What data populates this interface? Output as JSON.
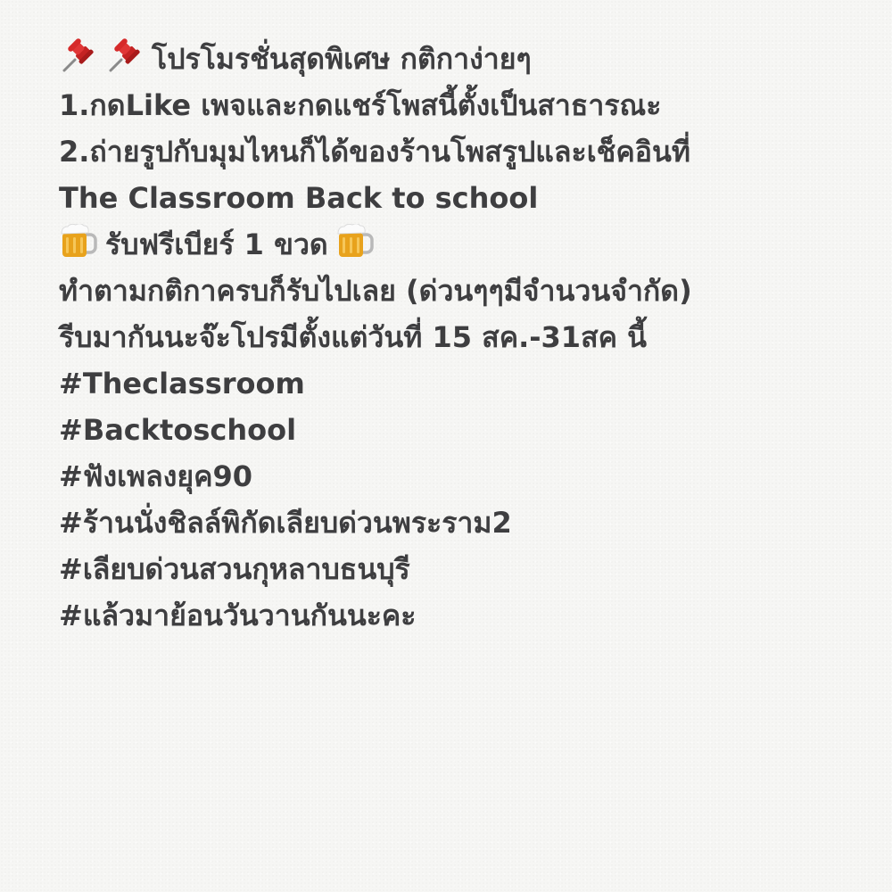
{
  "note": {
    "title": "โปรโมรชั่นสุดพิเศษ กติกาง่ายๆ",
    "rule_1": "1.กดLike เพจและกดแชร์โพสนี้ตั้งเป็นสาธารณะ",
    "rule_2": "2.ถ่ายรูปกับมุมไหนก็ได้ของร้านโพสรูปและเช็คอินที่",
    "shop_name": "The Classroom Back to school",
    "reward": "รับฟรีเบียร์ 1 ขวด",
    "condition": "ทำตามกติกาครบก็รับไปเลย (ด่วนๆๆมีจำนวนจำกัด)",
    "period": "รีบมากันนะจ๊ะโปรมีตั้งแต่วันที่ 15 สค.-31สค นี้",
    "hashtags": [
      "#Theclassroom",
      "#Backtoschool",
      "#ฟังเพลงยุค90",
      "#ร้านนั่งชิลล์พิกัดเลียบด่วนพระราม2",
      "#เลียบด่วนสวนกุหลาบธนบุรี",
      "#แล้วมาย้อนวันวานกันนะคะ"
    ],
    "icons": {
      "title_prefix": [
        "pushpin-icon",
        "pushpin-icon"
      ],
      "reward_prefix": "beer-mug-icon",
      "reward_suffix": "beer-mug-icon"
    }
  },
  "colors": {
    "background": "#f6f6f4",
    "text": "#3e3e40",
    "pin_red": "#d62a2a",
    "beer_amber": "#e8a21c"
  }
}
